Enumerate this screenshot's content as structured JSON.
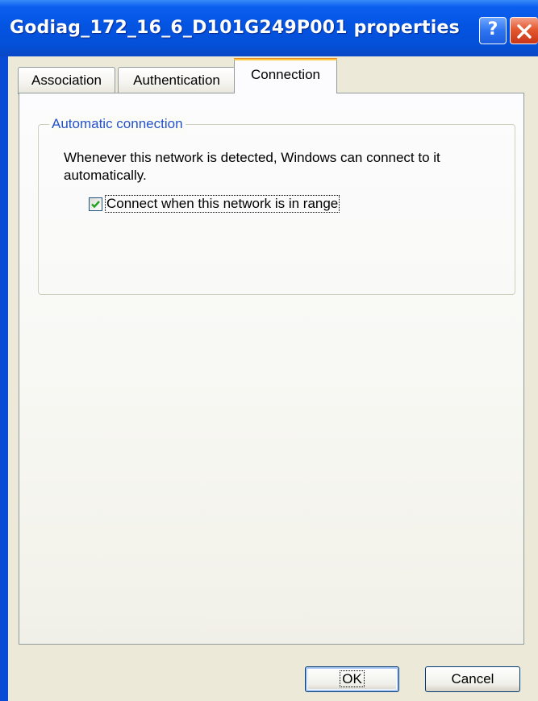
{
  "window": {
    "title": "Godiag_172_16_6_D101G249P001 properties",
    "help_label": "?",
    "help_icon": "help-icon",
    "close_icon": "close-icon"
  },
  "tabs": [
    {
      "label": "Association",
      "selected": false
    },
    {
      "label": "Authentication",
      "selected": false
    },
    {
      "label": "Connection",
      "selected": true
    }
  ],
  "connection": {
    "group_title": "Automatic connection",
    "description": "Whenever this network is detected, Windows can connect to it automatically.",
    "checkbox_label": "Connect when this network is in range",
    "checkbox_checked": true
  },
  "buttons": {
    "ok_label": "OK",
    "cancel_label": "Cancel"
  },
  "colors": {
    "titlebar": "#0454e2",
    "active_tab_highlight": "#ffc83c",
    "group_title": "#2452c8",
    "checkmark": "#21a121"
  }
}
